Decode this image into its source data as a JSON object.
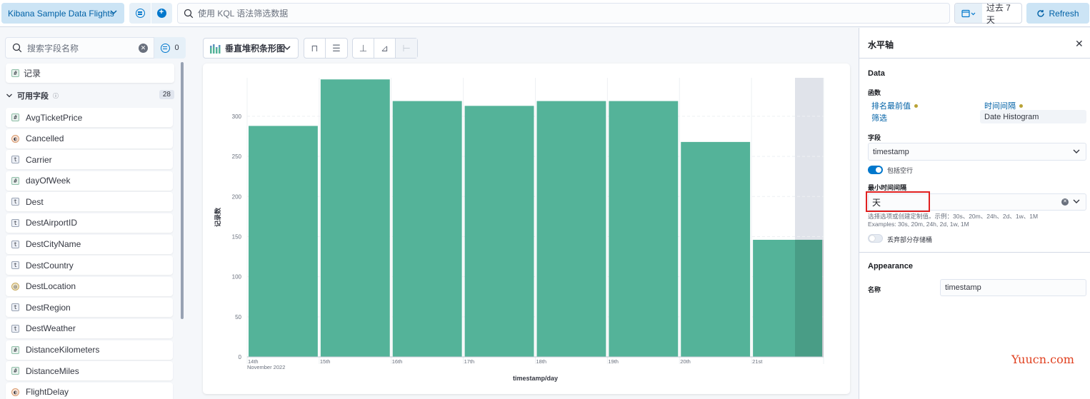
{
  "topbar": {
    "data_view": "Kibana Sample Data Flights",
    "search_placeholder": "使用 KQL 语法筛选数据",
    "date_range": "过去 7 天",
    "refresh_label": "Refresh"
  },
  "sidebar": {
    "search_placeholder": "搜索字段名称",
    "filter_count": "0",
    "records_label": "记录",
    "available_label": "可用字段",
    "available_count": "28",
    "fields": [
      {
        "name": "AvgTicketPrice",
        "type": "number",
        "glyph": "#"
      },
      {
        "name": "Cancelled",
        "type": "bool",
        "glyph": "◐"
      },
      {
        "name": "Carrier",
        "type": "string",
        "glyph": "t"
      },
      {
        "name": "dayOfWeek",
        "type": "number",
        "glyph": "#"
      },
      {
        "name": "Dest",
        "type": "string",
        "glyph": "t"
      },
      {
        "name": "DestAirportID",
        "type": "string",
        "glyph": "t"
      },
      {
        "name": "DestCityName",
        "type": "string",
        "glyph": "t"
      },
      {
        "name": "DestCountry",
        "type": "string",
        "glyph": "t"
      },
      {
        "name": "DestLocation",
        "type": "geo",
        "glyph": "◎"
      },
      {
        "name": "DestRegion",
        "type": "string",
        "glyph": "t"
      },
      {
        "name": "DestWeather",
        "type": "string",
        "glyph": "t"
      },
      {
        "name": "DistanceKilometers",
        "type": "number",
        "glyph": "#"
      },
      {
        "name": "DistanceMiles",
        "type": "number",
        "glyph": "#"
      },
      {
        "name": "FlightDelay",
        "type": "bool",
        "glyph": "◐"
      }
    ]
  },
  "toolbar": {
    "chart_type_label": "垂直堆积条形图"
  },
  "chart_data": {
    "type": "bar",
    "categories": [
      "14th",
      "15th",
      "16th",
      "17th",
      "18th",
      "19th",
      "20th",
      "21st"
    ],
    "values": [
      288,
      346,
      319,
      313,
      319,
      319,
      268,
      146
    ],
    "xlabel": "timestamp/day",
    "ylabel": "记录数",
    "x_sublabel": "November 2022",
    "ylim": [
      0,
      348
    ],
    "yticks": [
      0,
      50,
      100,
      150,
      200,
      250,
      300
    ],
    "bar_color": "#54b399",
    "partial_bucket_color": "#e0e3ea",
    "grid": true
  },
  "config": {
    "title": "水平轴",
    "data_section": "Data",
    "function_label": "函数",
    "fn_top_values": "排名最前值",
    "fn_interval": "时间间隔",
    "fn_filters": "筛选",
    "fn_date_histogram": "Date Histogram",
    "field_label": "字段",
    "field_value": "timestamp",
    "include_empty_label": "包括空行",
    "include_empty_on": true,
    "min_interval_label": "最小时间间隔",
    "min_interval_value": "天",
    "help_cn": "选择选项或创建定制值。示例：30s、20m、24h、2d、1w、1M",
    "help_en": "Examples: 30s, 20m, 24h, 2d, 1w, 1M",
    "drop_partial_label": "丢弃部分存储桶",
    "drop_partial_on": false,
    "appearance_section": "Appearance",
    "name_label": "名称",
    "name_value": "timestamp"
  },
  "watermark": "Yuucn.com"
}
